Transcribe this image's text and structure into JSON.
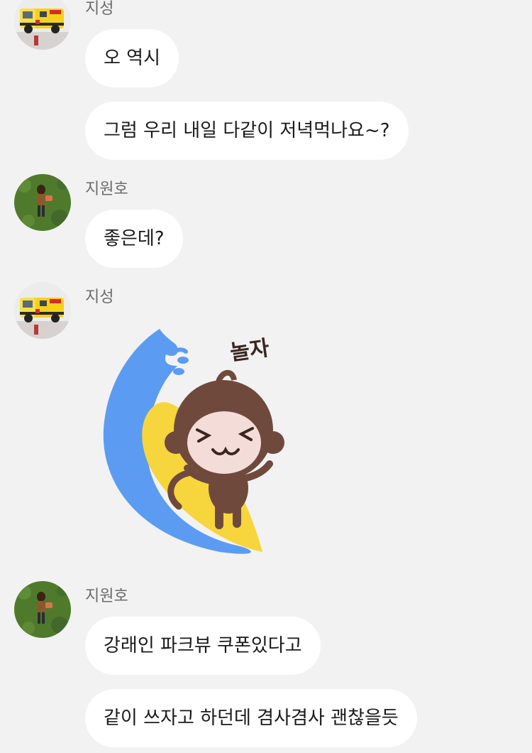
{
  "messages": [
    {
      "sender": "지성",
      "text": "오 역시"
    },
    {
      "text": "그럼 우리 내일 다같이 저녁먹나요~?"
    },
    {
      "sender": "지원호",
      "text": "좋은데?"
    },
    {
      "sender": "지성",
      "sticker": {
        "caption": "놀자",
        "icon": "monkey-surfing-sticker"
      }
    },
    {
      "sender": "지원호",
      "text": "강래인 파크뷰 쿠폰있다고"
    },
    {
      "text": "같이 쓰자고 하던데 겸사겸사 괜찮을듯"
    }
  ],
  "colors": {
    "background": "#f2f2f2",
    "bubble": "#ffffff",
    "sender": "#6b6b6b",
    "text": "#1a1a1a"
  }
}
